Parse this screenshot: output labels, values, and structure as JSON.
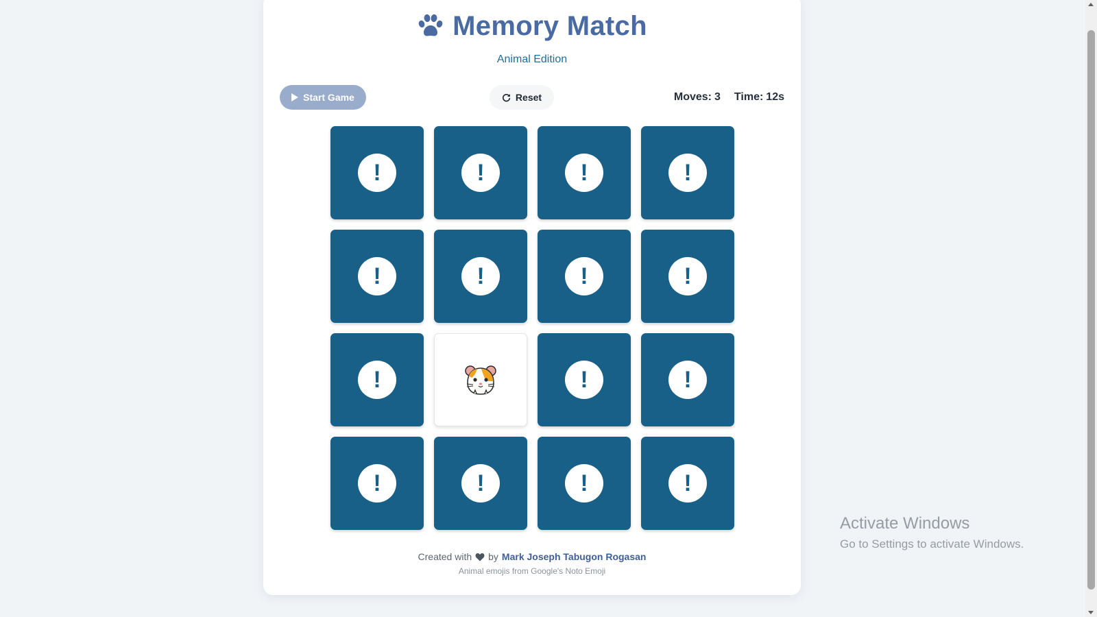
{
  "header": {
    "title": "Memory Match",
    "subtitle": "Animal Edition",
    "icon": "paw-icon"
  },
  "controls": {
    "start_label": "Start Game",
    "start_icon": "play-icon",
    "start_enabled": false,
    "reset_label": "Reset",
    "reset_icon": "refresh-icon"
  },
  "stats": {
    "moves_label": "Moves:",
    "moves_value": "3",
    "time_label": "Time:",
    "time_value": "12s"
  },
  "board": {
    "rows": 4,
    "cols": 4,
    "hidden_icon": "exclamation-icon",
    "hidden_symbol": "!",
    "cards": [
      {
        "state": "hidden"
      },
      {
        "state": "hidden"
      },
      {
        "state": "hidden"
      },
      {
        "state": "hidden"
      },
      {
        "state": "hidden"
      },
      {
        "state": "hidden"
      },
      {
        "state": "hidden"
      },
      {
        "state": "hidden"
      },
      {
        "state": "hidden"
      },
      {
        "state": "flipped",
        "animal": "hamster-icon"
      },
      {
        "state": "hidden"
      },
      {
        "state": "hidden"
      },
      {
        "state": "hidden"
      },
      {
        "state": "hidden"
      },
      {
        "state": "hidden"
      },
      {
        "state": "hidden"
      }
    ]
  },
  "footer": {
    "created_prefix": "Created with",
    "heart_icon": "heart-icon",
    "by": "by",
    "author": "Mark Joseph Tabugon Rogasan",
    "credits": "Animal emojis from Google's Noto Emoji"
  },
  "watermark": {
    "title": "Activate Windows",
    "subtitle": "Go to Settings to activate Windows."
  },
  "colors": {
    "accent": "#4a6aa3",
    "card_back": "#186088",
    "start_button": "#9aaccc",
    "background": "#f1f4f7"
  }
}
